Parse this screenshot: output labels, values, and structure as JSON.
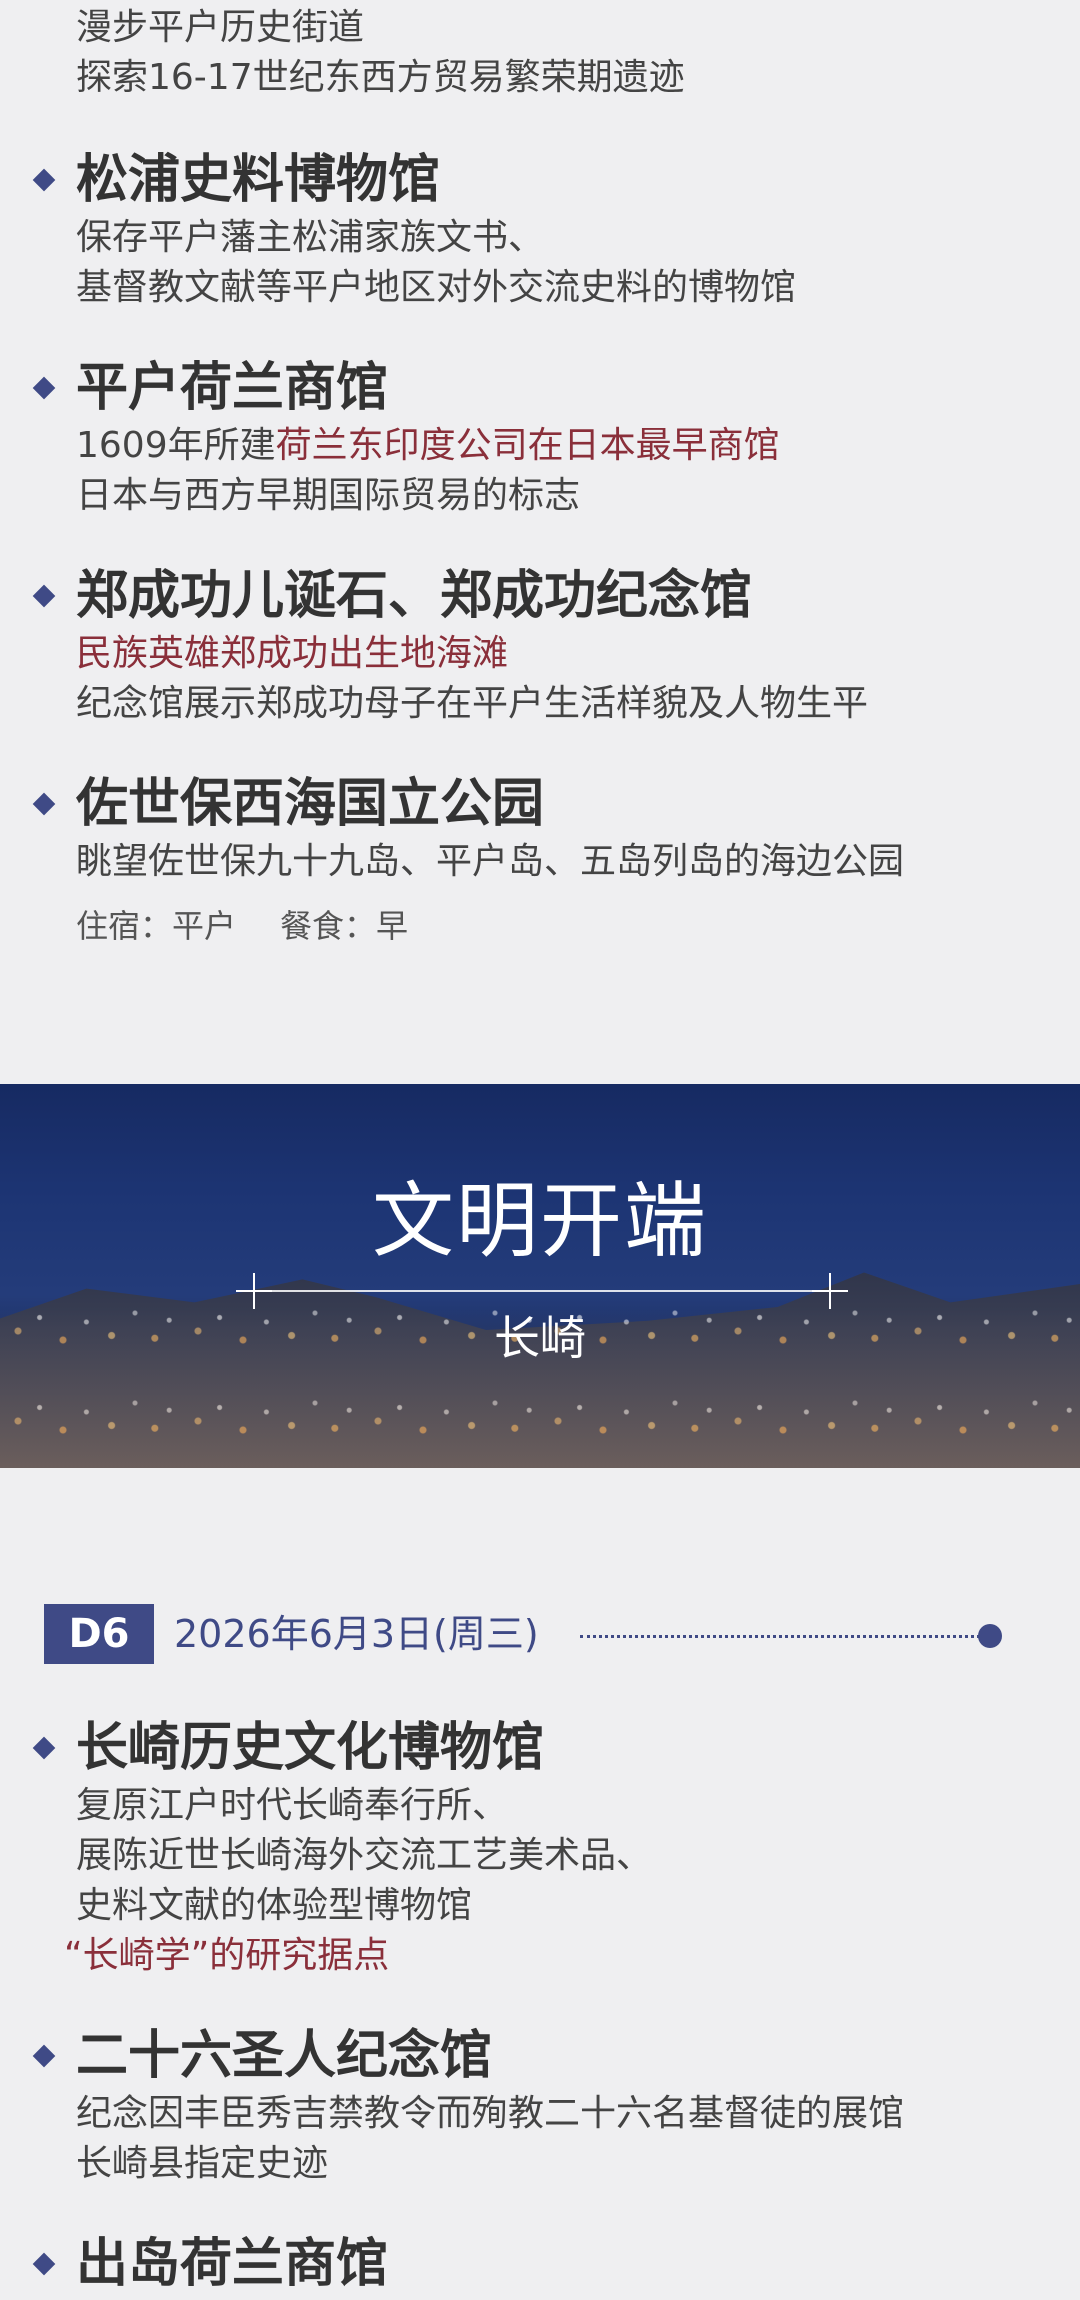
{
  "intro": {
    "line1": "漫步平户历史街道",
    "line2": "探索16-17世纪东西方贸易繁荣期遗迹"
  },
  "d5_items": [
    {
      "title": "松浦史料博物馆",
      "line1": "保存平户藩主松浦家族文书、",
      "line2": "基督教文献等平户地区对外交流史料的博物馆"
    },
    {
      "title": "平户荷兰商馆",
      "line1_prefix": "1609年所建",
      "line1_highlight": "荷兰东印度公司在日本最早商馆",
      "line2": "日本与西方早期国际贸易的标志"
    },
    {
      "title": "郑成功儿诞石、郑成功纪念馆",
      "line1": "民族英雄郑成功出生地海滩",
      "line2": "纪念馆展示郑成功母子在平户生活样貌及人物生平"
    },
    {
      "title": "佐世保西海国立公园",
      "line1": "眺望佐世保九十九岛、平户岛、五岛列岛的海边公园"
    }
  ],
  "stay": {
    "lodging": "住宿：平户",
    "meals": "餐食：早"
  },
  "banner": {
    "title": "文明开端",
    "subtitle": "长崎"
  },
  "day6": {
    "badge": "D6",
    "date": "2026年6月3日(周三)"
  },
  "d6_items": [
    {
      "title": "长崎历史文化博物馆",
      "line1": "复原江户时代长崎奉行所、",
      "line2": "展陈近世长崎海外交流工艺美术品、",
      "line3": "史料文献的体验型博物馆",
      "line4": "“长崎学”的研究据点"
    },
    {
      "title": "二十六圣人纪念馆",
      "line1": "纪念因丰臣秀吉禁教令而殉教二十六名基督徒的展馆",
      "line2": "长崎县指定史迹"
    },
    {
      "title": "出岛荷兰商馆"
    }
  ],
  "colors": {
    "accent": "#3f4a86",
    "highlight": "#8a2f3a",
    "background": "#efeff1",
    "text": "#444444"
  }
}
